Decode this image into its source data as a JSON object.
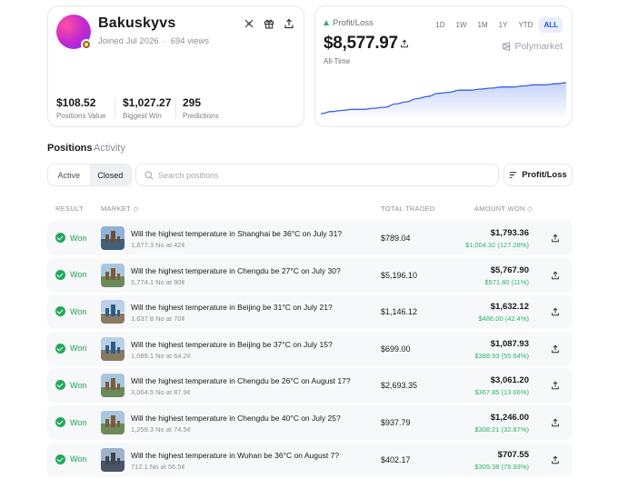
{
  "profile": {
    "username": "Bakuskyvs",
    "joined": "Joined Jul 2026",
    "views": "694 views",
    "stats": [
      {
        "value": "$108.52",
        "label": "Positions Value"
      },
      {
        "value": "$1,027.27",
        "label": "Biggest Win"
      },
      {
        "value": "295",
        "label": "Predictions"
      }
    ],
    "icons": [
      "transfer-icon",
      "gift-icon",
      "share-icon"
    ]
  },
  "pnl": {
    "label": "Profit/Loss",
    "value": "$8,577.97",
    "period": "All-Time",
    "brand": "Polymarket",
    "ranges": [
      "1D",
      "1W",
      "1M",
      "1Y",
      "YTD",
      "ALL"
    ],
    "active_range": "ALL",
    "accent": "#1652f0",
    "chart_series": [
      0,
      2,
      3,
      4,
      4,
      5,
      6,
      9,
      11,
      14,
      16,
      19,
      20,
      22,
      22,
      23,
      24,
      25,
      25,
      26,
      27,
      27,
      28,
      29
    ]
  },
  "tabs": {
    "positions": "Positions",
    "activity": "Activity"
  },
  "filters": {
    "active": "Active",
    "closed": "Closed",
    "selected": "Closed",
    "search_placeholder": "Search positions",
    "sort_label": "Profit/Loss"
  },
  "table": {
    "headers": {
      "result": "RESULT",
      "market": "MARKET",
      "traded": "TOTAL TRADED",
      "won": "AMOUNT WON"
    },
    "rows": [
      {
        "result": "Won",
        "title": "Will the highest temperature in Shanghai be 36°C on July 31?",
        "sub": "1,877.3 No at 42¢",
        "traded": "$789.04",
        "won": "$1,793.36",
        "profit": "$1,004.32 (127.28%)",
        "thumb": "shanghai"
      },
      {
        "result": "Won",
        "title": "Will the highest temperature in Chengdu be 27°C on July 30?",
        "sub": "5,774.1 No at 90¢",
        "traded": "$5,196.10",
        "won": "$5,767.90",
        "profit": "$571.80 (11%)",
        "thumb": "chengdu"
      },
      {
        "result": "Won",
        "title": "Will the highest temperature in Beijing be 31°C on July 21?",
        "sub": "1,637.8 No at 70¢",
        "traded": "$1,146.12",
        "won": "$1,632.12",
        "profit": "$486.00 (42.4%)",
        "thumb": "beijing"
      },
      {
        "result": "Won",
        "title": "Will the highest temperature in Beijing be 37°C on July 15?",
        "sub": "1,089.1 No at 64.2¢",
        "traded": "$699.00",
        "won": "$1,087.93",
        "profit": "$388.93 (55.64%)",
        "thumb": "beijing"
      },
      {
        "result": "Won",
        "title": "Will the highest temperature in Chengdu be 26°C on August 17?",
        "sub": "3,064.5 No at 87.9¢",
        "traded": "$2,693.35",
        "won": "$3,061.20",
        "profit": "$367.85 (13.66%)",
        "thumb": "chengdu"
      },
      {
        "result": "Won",
        "title": "Will the highest temperature in Chengdu be 40°C on July 25?",
        "sub": "1,259.3 No at 74.5¢",
        "traded": "$937.79",
        "won": "$1,246.00",
        "profit": "$308.21 (32.87%)",
        "thumb": "chengdu"
      },
      {
        "result": "Won",
        "title": "Will the highest temperature in Wuhan be 36°C on August 7?",
        "sub": "712.1 No at 56.5¢",
        "traded": "$402.17",
        "won": "$707.55",
        "profit": "$305.38 (75.93%)",
        "thumb": "wuhan"
      }
    ]
  }
}
